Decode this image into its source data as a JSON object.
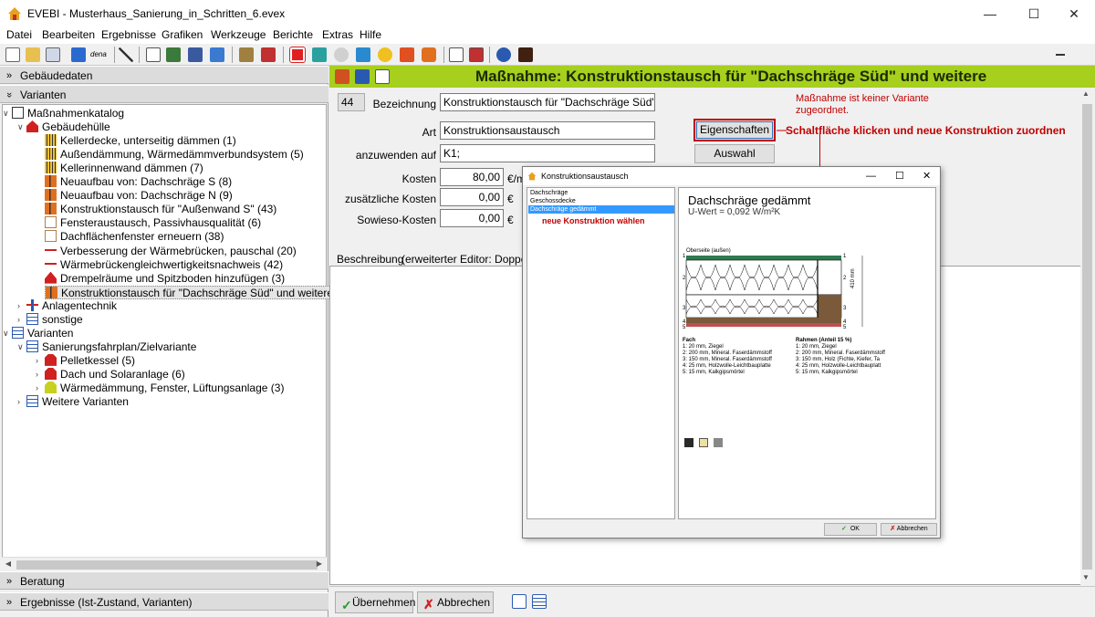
{
  "window": {
    "title": "EVEBI - Musterhaus_Sanierung_in_Schritten_6.evex",
    "minimize": "—",
    "maximize": "☐",
    "close": "✕"
  },
  "menu": [
    "Datei",
    "Bearbeiten",
    "Ergebnisse",
    "Grafiken",
    "Werkzeuge",
    "Berichte",
    "Extras",
    "Hilfe"
  ],
  "toolbar": {
    "dena_label": "dena"
  },
  "left": {
    "sections": {
      "gebaeudedaten": "Gebäudedaten",
      "varianten": "Varianten",
      "beratung": "Beratung",
      "ergebnisse": "Ergebnisse (Ist-Zustand, Varianten)"
    },
    "tree": [
      {
        "label": "Maßnahmenkatalog"
      },
      {
        "label": "Gebäudehülle"
      },
      {
        "label": "Kellerdecke, unterseitig dämmen (1)"
      },
      {
        "label": "Außendämmung, Wärmedämmverbundsystem (5)"
      },
      {
        "label": "Kellerinnenwand dämmen (7)"
      },
      {
        "label": "Neuaufbau von: Dachschräge S (8)"
      },
      {
        "label": "Neuaufbau von: Dachschräge N (9)"
      },
      {
        "label": "Konstruktionstausch für \"Außenwand S\" (43)"
      },
      {
        "label": "Fensteraustausch, Passivhausqualität (6)"
      },
      {
        "label": "Dachflächenfenster erneuern (38)"
      },
      {
        "label": "Verbesserung der Wärmebrücken, pauschal (20)"
      },
      {
        "label": "Wärmebrückengleichwertigkeitsnachweis (42)"
      },
      {
        "label": "Drempelräume und Spitzboden hinzufügen (3)"
      },
      {
        "label": "Konstruktionstausch für \"Dachschräge Süd\" und weitere (44)"
      },
      {
        "label": "Anlagentechnik"
      },
      {
        "label": "sonstige"
      },
      {
        "label": "Varianten"
      },
      {
        "label": "Sanierungsfahrplan/Zielvariante"
      },
      {
        "label": "Pelletkessel (5)"
      },
      {
        "label": "Dach und Solaranlage (6)"
      },
      {
        "label": "Wärmedämmung, Fenster, Lüftungsanlage (3)"
      },
      {
        "label": "Weitere Varianten"
      }
    ]
  },
  "main": {
    "title": "Maßnahme: Konstruktionstausch für \"Dachschräge Süd\" und weitere",
    "id": "44",
    "labels": {
      "bezeichnung": "Bezeichnung",
      "art": "Art",
      "anzuwenden": "anzuwenden auf",
      "kosten": "Kosten",
      "zusaetzliche": "zusätzliche Kosten",
      "sowieso": "Sowieso-Kosten",
      "beschreibung": "Beschreibung",
      "editor": "(erweiterter Editor: Doppelklick"
    },
    "values": {
      "bezeichnung": "Konstruktionstausch für \"Dachschräge Süd\" und we",
      "art": "Konstruktionsaustausch",
      "anzuwenden": "K1;",
      "kosten": "80,00",
      "zusaetzliche": "0,00",
      "sowieso": "0,00"
    },
    "units": {
      "kosten": "€/m",
      "zusaetzliche": "€",
      "sowieso": "€"
    },
    "buttons": {
      "eigenschaften": "Eigenschaften",
      "auswahl": "Auswahl",
      "uebernehmen": "Übernehmen",
      "abbrechen": "Abbrechen"
    },
    "note": "Maßnahme ist keiner Variante zugeordnet.",
    "annotation": "Schaltfläche klicken und neue Konstruktion zuordnen",
    "accent_color": "#a6cf1e",
    "annotation_color": "#c00000"
  },
  "dialog": {
    "title": "Konstruktionsaustausch",
    "list": [
      "Dachschräge",
      "Geschossdecke",
      "Dachschräge gedämmt"
    ],
    "list_selected": 2,
    "hint": "neue Konstruktion wählen",
    "heading": "Dachschräge gedämmt",
    "uwert": "U-Wert = 0,092 W/m²K",
    "oberseite": "Oberseite (außen)",
    "dimension": "410 mm",
    "layer_numbers": [
      "1",
      "2",
      "3",
      "4",
      "5"
    ],
    "fach_title": "Fach",
    "fach": [
      "1:  20 mm, Ziegel",
      "2:  200 mm, Mineral. Faserdämmstoff",
      "3:  150 mm, Mineral. Faserdämmstoff",
      "4:  25 mm, Holzwolle-Leichtbauplatte",
      "5:  15 mm, Kalkgipsmörtel"
    ],
    "rahmen_title": "Rahmen (Anteil 15 %)",
    "rahmen": [
      "1:  20 mm, Ziegel",
      "2:  200 mm, Mineral. Faserdämmstoff",
      "3:  150 mm, Holz (Fichte, Kiefer, Ta",
      "4:  25 mm, Holzwolle-Leichtbauplatt",
      "5:  15 mm, Kalkgipsmörtel"
    ],
    "ok": "OK",
    "cancel": "Abbrechen"
  }
}
